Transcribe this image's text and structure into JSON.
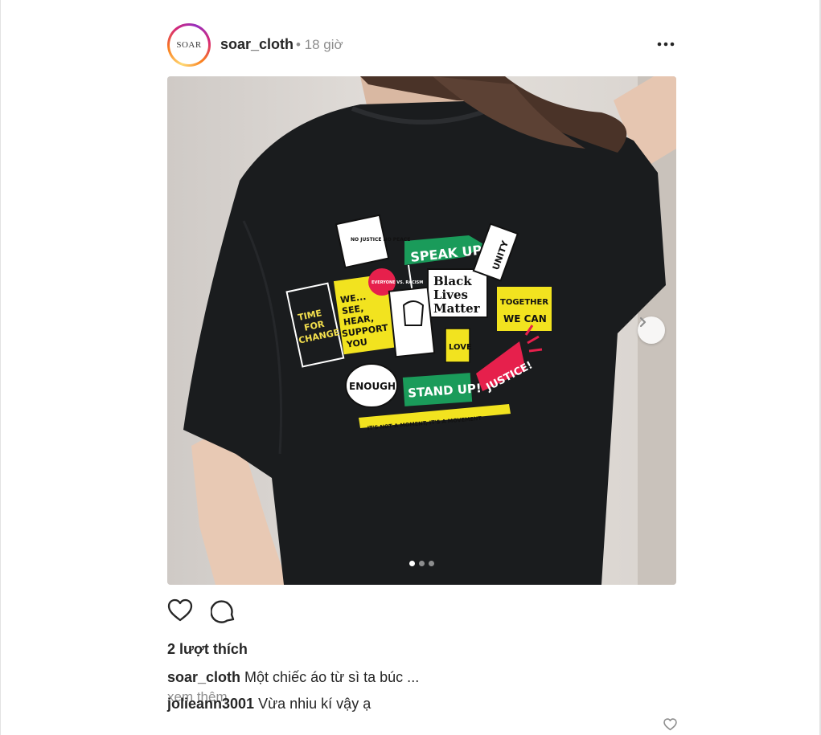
{
  "post": {
    "author": "soar_cloth",
    "time": "• 18 giờ",
    "avatar_logo": "SOAR",
    "more_icon": "more-horizontal-icon",
    "image": {
      "slide_count": 3,
      "active_slide": 1,
      "print_texts": {
        "speak": "SPEAK UP!",
        "blm1": "Black",
        "blm2": "Lives",
        "blm3": "Matter",
        "time1": "TIME",
        "time2": "FOR",
        "time3": "CHANGE",
        "we1": "WE...",
        "we2": "SEE,",
        "we3": "HEAR,",
        "we4": "SUPPORT",
        "we5": "YOU",
        "unity": "UNITY",
        "together1": "TOGETHER",
        "together2": "WE CAN",
        "enough": "ENOUGH",
        "stand": "STAND UP!",
        "justice": "JUSTICE!",
        "love": "LOVE",
        "nojustice": "NO JUSTICE NO PEACE",
        "everyone": "EVERYONE VS. RACISM",
        "movement": "IT'S NOT A MOMENT, IT'S A MOVEMENT"
      }
    },
    "likes": "2 lượt thích",
    "caption": {
      "username": "soar_cloth",
      "text": "Một chiếc áo từ sì ta búc ..."
    },
    "see_more": "xem thêm",
    "comment": {
      "username": "jolieann3001",
      "text": "Vừa nhiu kí vậy ạ"
    }
  },
  "colors": {
    "story_ring_start": "#feda75",
    "story_ring_mid": "#d62976",
    "story_ring_end": "#962fbf",
    "muted": "#8e8e8e",
    "text": "#262626"
  }
}
